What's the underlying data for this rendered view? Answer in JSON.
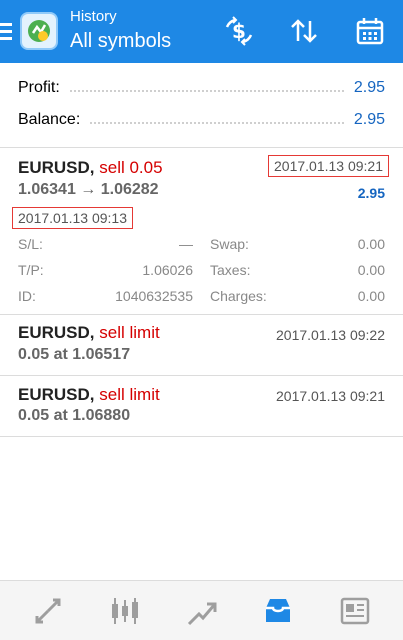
{
  "header": {
    "title_small": "History",
    "title_big": "All symbols",
    "icons": [
      "menu-icon",
      "app-logo-icon",
      "dollar-exchange-icon",
      "sort-icon",
      "calendar-icon"
    ],
    "bg_color": "#1e88e5"
  },
  "summary": {
    "profit_label": "Profit:",
    "profit_value": "2.95",
    "balance_label": "Balance:",
    "balance_value": "2.95"
  },
  "deals": [
    {
      "symbol": "EURUSD,",
      "type": "sell 0.05",
      "close_time": "2017.01.13 09:21",
      "prices": "1.06341 → 1.06282",
      "profit": "2.95",
      "open_time": "2017.01.13 09:13",
      "sl_label": "S/L:",
      "sl_value": "—",
      "tp_label": "T/P:",
      "tp_value": "1.06026",
      "id_label": "ID:",
      "id_value": "1040632535",
      "swap_label": "Swap:",
      "swap_value": "0.00",
      "taxes_label": "Taxes:",
      "taxes_value": "0.00",
      "charges_label": "Charges:",
      "charges_value": "0.00"
    },
    {
      "symbol": "EURUSD,",
      "type": "sell limit",
      "time": "2017.01.13 09:22",
      "details": "0.05 at 1.06517"
    },
    {
      "symbol": "EURUSD,",
      "type": "sell limit",
      "time": "2017.01.13 09:21",
      "details": "0.05 at 1.06880"
    }
  ],
  "bottom_nav": {
    "items": [
      "quotes-icon",
      "chart-icon",
      "trade-icon",
      "history-icon",
      "news-icon"
    ],
    "active": "history-icon",
    "active_color": "#1e88e5",
    "inactive_color": "#9e9e9e"
  }
}
